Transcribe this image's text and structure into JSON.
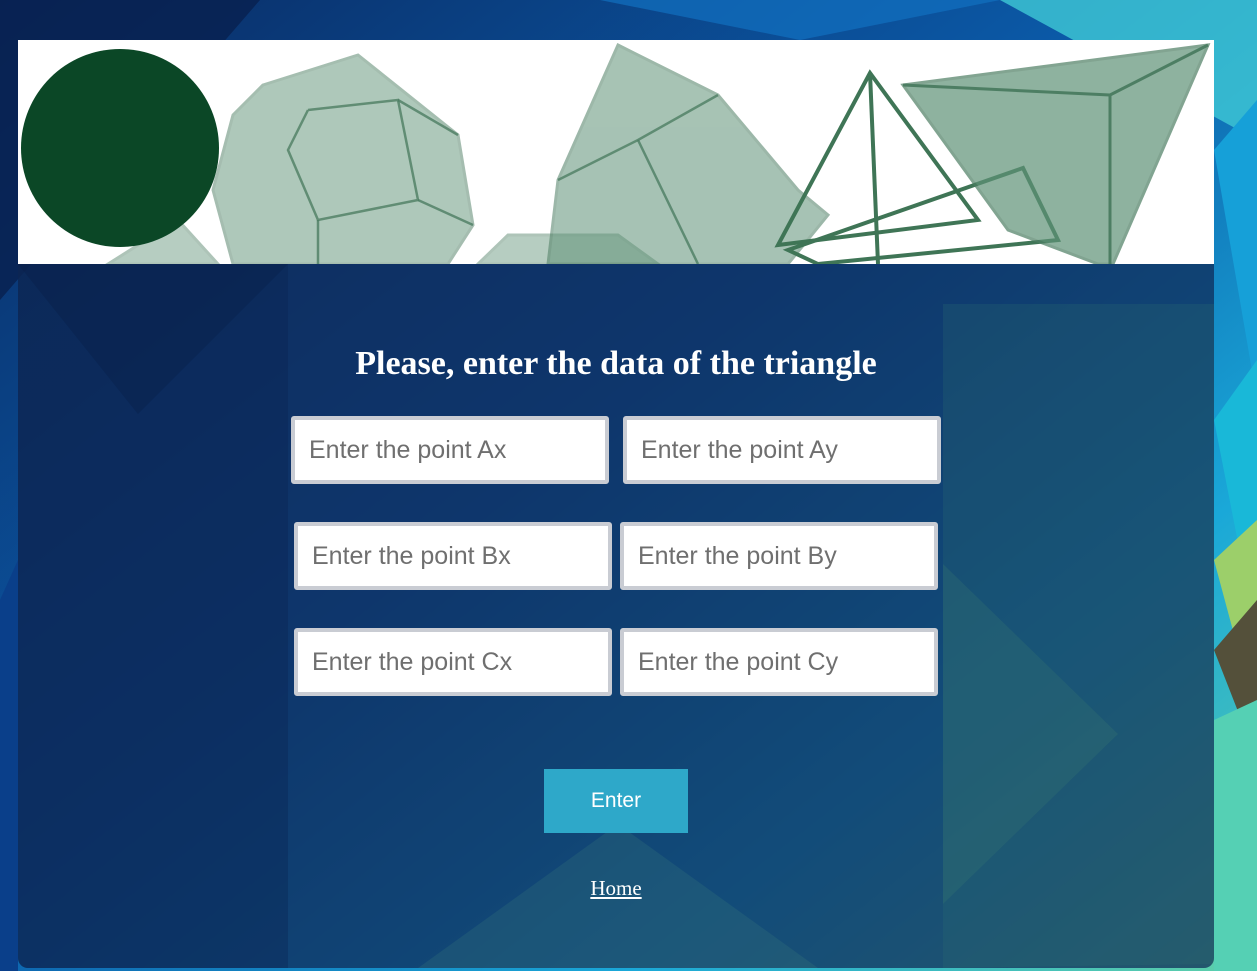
{
  "form": {
    "title": "Please, enter the data of the triangle",
    "fields": {
      "ax": {
        "placeholder": "Enter the point Ax",
        "value": ""
      },
      "ay": {
        "placeholder": "Enter the point Ay",
        "value": ""
      },
      "bx": {
        "placeholder": "Enter the point Bx",
        "value": ""
      },
      "by": {
        "placeholder": "Enter the point By",
        "value": ""
      },
      "cx": {
        "placeholder": "Enter the point Cx",
        "value": ""
      },
      "cy": {
        "placeholder": "Enter the point Cy",
        "value": ""
      }
    },
    "submit_label": "Enter",
    "home_link_label": "Home"
  },
  "colors": {
    "panel": "#0f2855",
    "button": "#2ea8c9",
    "banner_circle": "#0b4726",
    "banner_shapes": "#5f9277"
  }
}
